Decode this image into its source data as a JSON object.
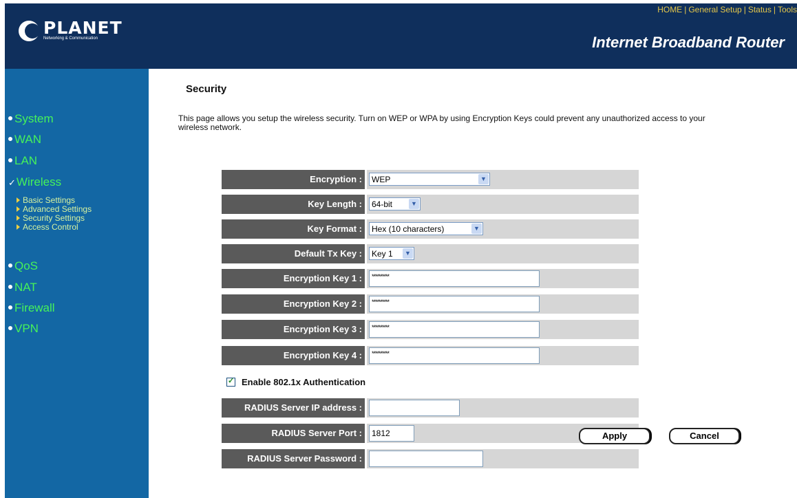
{
  "header": {
    "logo_name": "PLANET",
    "logo_sub": "Networking & Communication",
    "product": "Internet Broadband Router",
    "topnav": [
      "HOME",
      "General Setup",
      "Status",
      "Tools"
    ]
  },
  "sidebar": {
    "items": [
      {
        "label": "System"
      },
      {
        "label": "WAN"
      },
      {
        "label": "LAN"
      },
      {
        "label": "Wireless"
      },
      {
        "label": "QoS"
      },
      {
        "label": "NAT"
      },
      {
        "label": "Firewall"
      },
      {
        "label": "VPN"
      }
    ],
    "subitems": [
      {
        "label": "Basic Settings"
      },
      {
        "label": "Advanced Settings"
      },
      {
        "label": "Security Settings"
      },
      {
        "label": "Access Control"
      }
    ]
  },
  "main": {
    "title": "Security",
    "description": "This page allows you setup the wireless security. Turn on WEP or WPA by using Encryption Keys could prevent any unauthorized access to your wireless network.",
    "encryption": {
      "label": "Encryption :",
      "value": "WEP"
    },
    "key_length": {
      "label": "Key Length :",
      "value": "64-bit"
    },
    "key_format": {
      "label": "Key Format :",
      "value": "Hex (10 characters)"
    },
    "default_tx_key": {
      "label": "Default Tx Key :",
      "value": "Key 1"
    },
    "keys": [
      {
        "label": "Encryption Key 1 :",
        "value": "**********"
      },
      {
        "label": "Encryption Key 2 :",
        "value": "**********"
      },
      {
        "label": "Encryption Key 3 :",
        "value": "**********"
      },
      {
        "label": "Encryption Key 4 :",
        "value": "**********"
      }
    ],
    "enable_8021x": {
      "label": "Enable 802.1x Authentication",
      "checked": true
    },
    "radius_ip": {
      "label": "RADIUS Server IP address :",
      "value": ""
    },
    "radius_port": {
      "label": "RADIUS Server Port :",
      "value": "1812"
    },
    "radius_password": {
      "label": "RADIUS Server Password :",
      "value": ""
    },
    "apply_label": "Apply",
    "cancel_label": "Cancel"
  },
  "colors": {
    "header_bg": "#0f2f5c",
    "sidebar_bg": "#1367a4",
    "nav_text": "#46f25a",
    "label_bg": "#5a5a5a",
    "row_bg": "#d6d6d6"
  }
}
